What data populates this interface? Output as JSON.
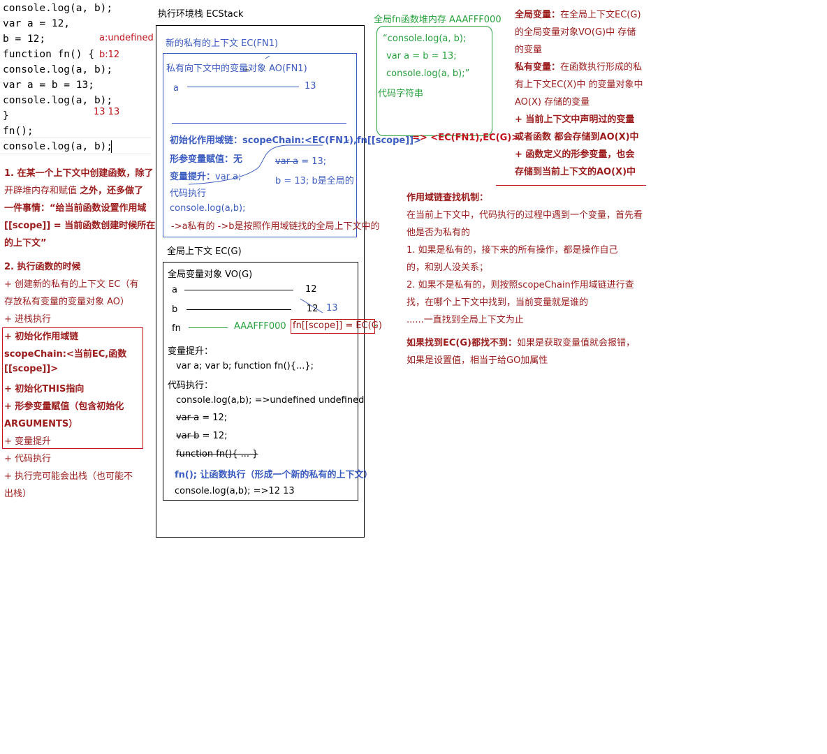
{
  "code": {
    "line1": "console.log(a, b);",
    "line2": "var a = 12,",
    "line3": "    b = 12;",
    "line4": "function fn() {",
    "line5": "    console.log(a, b);",
    "line6": "    var a = b = 13;",
    "line7": "    console.log(a, b);",
    "line8": "}",
    "line9": "fn();",
    "line10": "console.log(a, b);",
    "ann_a_undefined": "a:undefined",
    "ann_b12": "b:12",
    "ann_13_13": "13  13"
  },
  "notes_left": {
    "p1_l1": "1. 在某一个上下文中创建函数，除了",
    "p1_l2a": "开辟堆内存和赋值 ",
    "p1_l2b": "之外，还多做了",
    "p1_l3": "一件事情：“给当前函数设置作用域",
    "p1_l4": "[[scope]] = 当前函数创建时候所在",
    "p1_l5": "的上下文”",
    "p2_title": "2. 执行函数的时候",
    "p2_l1": "  + 创建新的私有的上下文 EC（有",
    "p2_l2": "存放私有变量的变量对象 AO）",
    "p2_l3": "  + 进栈执行",
    "p2_l4": "  + 初始化作用域链",
    "p2_l5": "  scopeChain:<当前EC,函数",
    "p2_l6": "[[scope]]>",
    "p2_l7": "  + 初始化THIS指向",
    "p2_l8": "  + 形参变量赋值（包含初始化",
    "p2_l9": "ARGUMENTS）",
    "p2_l10": "  + 变量提升",
    "p2_l11": "  + 代码执行",
    "p2_l12": "  + 执行完可能会出栈（也可能不",
    "p2_l13": "出栈）"
  },
  "stack": {
    "title": "执行环境栈 ECStack",
    "ec_fn1_title": "新的私有的上下文 EC(FN1)",
    "ao_title": "私有向下文中的变量对象 AO(FN1)",
    "ao_a_label": "a",
    "ao_a_value": "13",
    "scope_chain": "初始化作用域链：scopeChain:<EC(FN1),fn[[scope]]>",
    "param_assign": "形参变量赋值：无",
    "hoist_label": "变量提升：",
    "hoist_value": "var a;",
    "strike_var_a": "var a",
    "eq_13": " = 13;",
    "b_global": "b = 13; b是全局的",
    "code_exec": "代码执行",
    "console_ab": "console.log(a,b);",
    "arrow_note": "->a私有的   ->b是按照作用域链找的全局上下文中的",
    "ecg_title": "全局上下文 EC(G)",
    "vo_title": "全局变量对象 VO(G)",
    "vo_a_label": "a",
    "vo_a_value": "12",
    "vo_b_label": "b",
    "vo_b_old": "12",
    "vo_b_new": "13",
    "vo_fn_label": "fn",
    "vo_fn_value": "AAAFFF000",
    "fn_scope": "fn[[scope]] = EC(G)",
    "hoist_title": "变量提升：",
    "hoist_line": "var a;  var b;   function fn(){...};",
    "exec_title": "代码执行：",
    "exec_l1": "console.log(a,b);  =>undefined undefined",
    "exec_l2a": "var a",
    "exec_l2b": " = 12;",
    "exec_l3a": "var b",
    "exec_l3b": " = 12;",
    "exec_l4": "function fn(){ ... }",
    "exec_l5": "fn(); 让函数执行（形成一个新的私有的上下文）",
    "exec_l6": "console.log(a,b);  =>12  13"
  },
  "heap": {
    "title": "全局fn函数堆内存 AAAFFF000",
    "l1": "“console.log(a, b);",
    "l2": "var a = b = 13;",
    "l3": "console.log(a, b);”",
    "l4": "代码字符串",
    "scope_arrow": "=>  <EC(FN1),EC(G)>"
  },
  "notes_right": {
    "g_label": "全局变量：",
    "g_text1": "在全局上下文EC(G)",
    "g_text2": "的全局变量对象VO(G)中 存储",
    "g_text3": "的变量",
    "p_label": "私有变量：",
    "p_text1": "在函数执行形成的私",
    "p_text2": "有上下文EC(X)中 的变量对象中",
    "p_text3": "AO(X) 存储的变量",
    "p_l4": "  + 当前上下文中声明过的变量",
    "p_l5": "或者函数 都会存储到AO(X)中",
    "p_l6": "  + 函数定义的形参变量，也会",
    "p_l7": "存储到当前上下文的AO(X)中",
    "mech_title": "作用域链查找机制：",
    "mech_l1": "在当前上下文中，代码执行的过程中遇到一个变量，首先看",
    "mech_l2": "他是否为私有的",
    "mech_l3": "  1. 如果是私有的，接下来的所有操作，都是操作自己",
    "mech_l4": "的，和别人没关系；",
    "mech_l5": "  2. 如果不是私有的，则按照scopeChain作用域链进行查",
    "mech_l6": "找，在哪个上下文中找到，当前变量就是谁的",
    "mech_l7": "  ......一直找到全局上下文为止",
    "mech_l8a": "  如果找到EC(G)都找不到：",
    "mech_l8b": "如果是获取变量值就会报错，",
    "mech_l9": "  如果是设置值，相当于给GO加属性"
  }
}
